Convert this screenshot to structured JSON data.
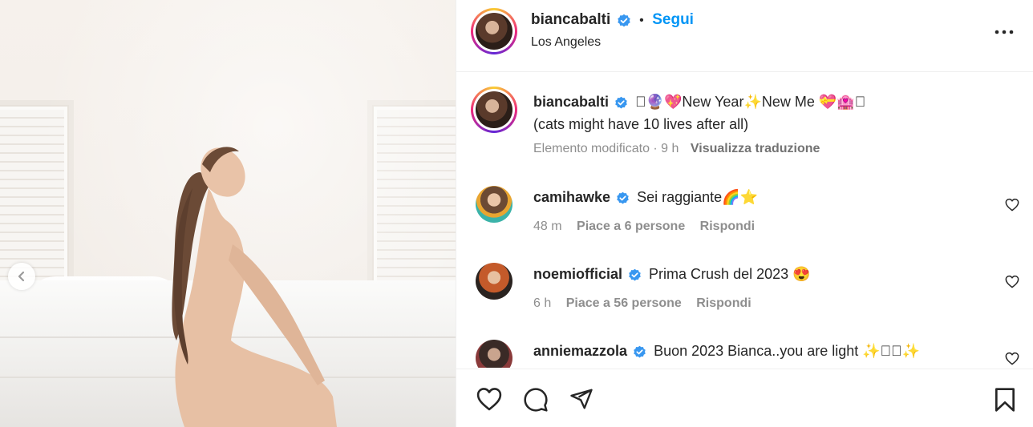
{
  "post": {
    "username": "biancabalti",
    "dot": "•",
    "follow_label": "Segui",
    "location": "Los Angeles"
  },
  "caption": {
    "username": "biancabalti",
    "line1": "􏰀🔮💖New Year✨New Me 💝🏩􏰀",
    "line2": "(cats might have 10 lives after all)",
    "edited": "Elemento modificato · 9 h",
    "translate": "Visualizza traduzione"
  },
  "comments": [
    {
      "username": "camihawke",
      "text": "Sei raggiante🌈⭐",
      "time": "48 m",
      "likes": "Piace a 6 persone",
      "reply": "Rispondi"
    },
    {
      "username": "noemiofficial",
      "text": "Prima Crush del 2023 😍",
      "time": "6 h",
      "likes": "Piace a 56 persone",
      "reply": "Rispondi"
    },
    {
      "username": "anniemazzola",
      "text": "Buon 2023 Bianca..you are light ✨􏰀􏰀✨",
      "time": "",
      "likes": "",
      "reply": ""
    }
  ],
  "icons": {
    "verified": "verified-badge-icon",
    "more": "more-options-icon",
    "like": "heart-icon",
    "comment": "comment-icon",
    "share": "share-icon",
    "save": "bookmark-icon",
    "prev": "chevron-left-icon"
  },
  "colors": {
    "follow": "#0095f6",
    "verified": "#3897f0",
    "text": "#262626",
    "muted": "#8e8e8e"
  }
}
